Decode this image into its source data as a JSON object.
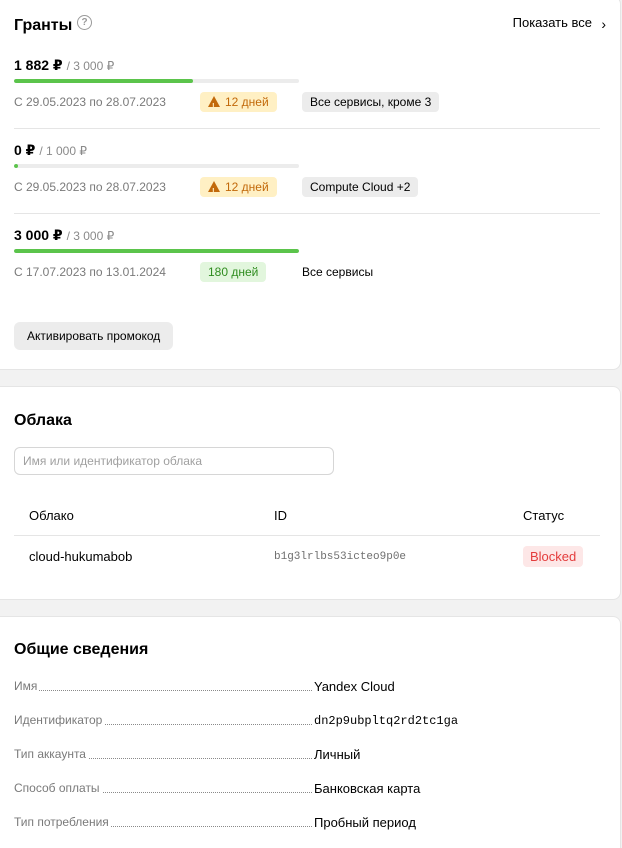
{
  "grants": {
    "title": "Гранты",
    "help_icon": "?",
    "show_all_label": "Показать все",
    "items": [
      {
        "amount": "1 882 ₽",
        "total": "/ 3 000 ₽",
        "progress": 0.627,
        "dates": "С 29.05.2023 по 28.07.2023",
        "days": "12 дней",
        "days_status": "warning",
        "scope": "Все сервисы, кроме 3"
      },
      {
        "amount": "0 ₽",
        "total": "/ 1 000 ₽",
        "progress": 0.0,
        "dates": "С 29.05.2023 по 28.07.2023",
        "days": "12 дней",
        "days_status": "warning",
        "scope": "Compute Cloud +2"
      },
      {
        "amount": "3 000 ₽",
        "total": "/ 3 000 ₽",
        "progress": 1.0,
        "dates": "С 17.07.2023 по 13.01.2024",
        "days": "180 дней",
        "days_status": "ok",
        "scope": "Все сервисы"
      }
    ],
    "promo_button_label": "Активировать промокод"
  },
  "clouds": {
    "title": "Облака",
    "search_placeholder": "Имя или идентификатор облака",
    "columns": [
      "Облако",
      "ID",
      "Статус"
    ],
    "rows": [
      {
        "name": "cloud-hukumabob",
        "id": "b1g3lrlbs53icteo9p0e",
        "status": "Blocked"
      }
    ]
  },
  "info": {
    "title": "Общие сведения",
    "rows": [
      {
        "label": "Имя",
        "value": "Yandex Cloud"
      },
      {
        "label": "Идентификатор",
        "value": "dn2p9ubpltq2rd2tc1ga"
      },
      {
        "label": "Тип аккаунта",
        "value": "Личный"
      },
      {
        "label": "Способ оплаты",
        "value": "Банковская карта"
      },
      {
        "label": "Тип потребления",
        "value": "Пробный период"
      }
    ]
  },
  "colors": {
    "progress_fill": "#5bc44b",
    "warning_bg": "#fff0c4",
    "warning_text": "#c2690a",
    "ok_bg": "#e2f6dd",
    "ok_text": "#2f8c1f",
    "blocked_bg": "#fde7e7",
    "blocked_text": "#e43c3c"
  }
}
